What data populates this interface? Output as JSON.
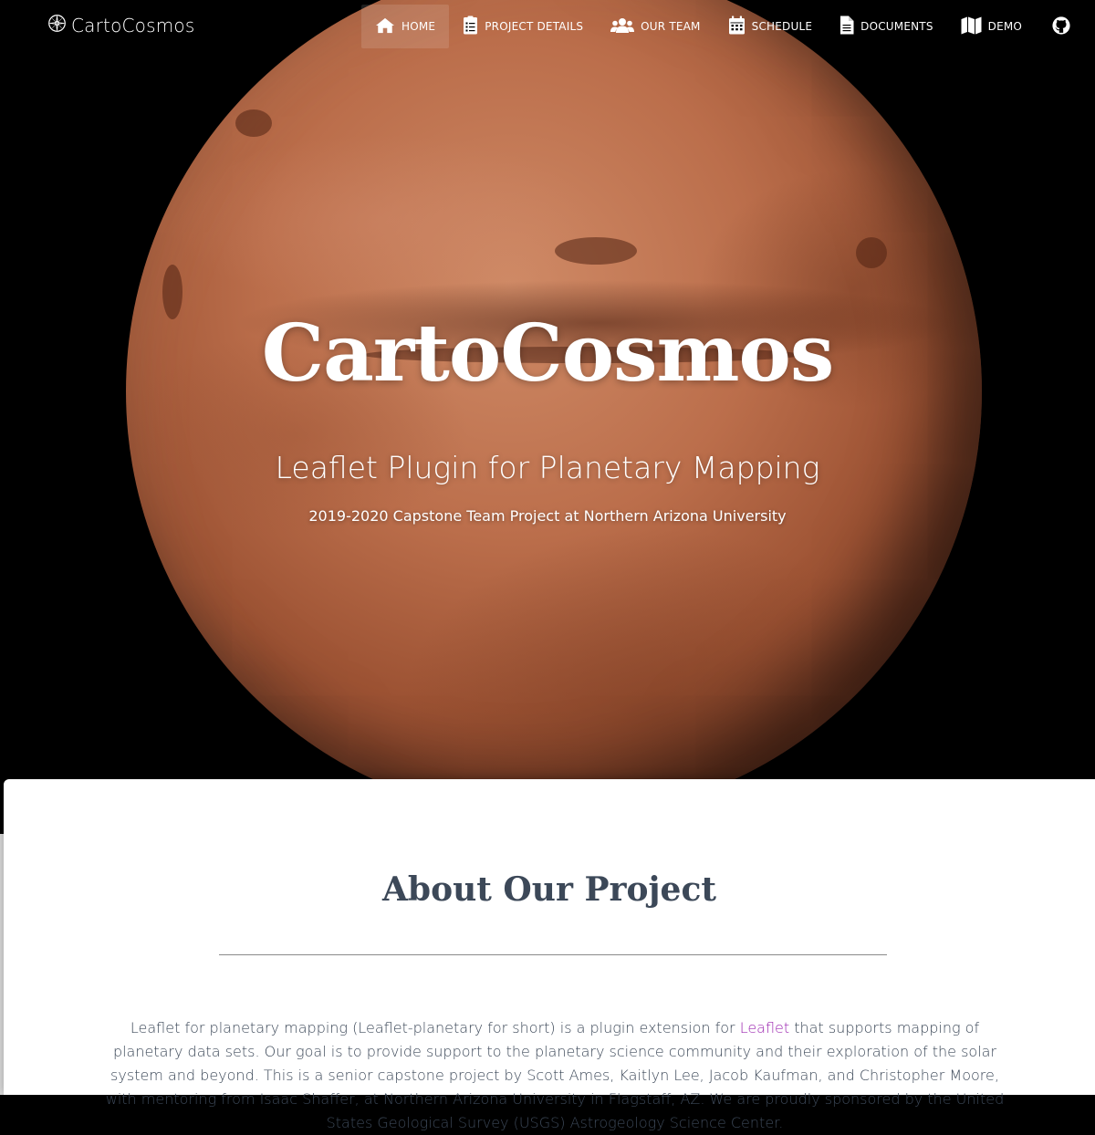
{
  "brand": {
    "name": "CartoCosmos",
    "icon": "compass-icon"
  },
  "nav": {
    "items": [
      {
        "label": "Home",
        "icon": "home-icon",
        "active": true
      },
      {
        "label": "Project Details",
        "icon": "clipboard-list-icon",
        "active": false
      },
      {
        "label": "Our Team",
        "icon": "users-icon",
        "active": false
      },
      {
        "label": "Schedule",
        "icon": "calendar-icon",
        "active": false
      },
      {
        "label": "Documents",
        "icon": "file-icon",
        "active": false
      },
      {
        "label": "Demo",
        "icon": "map-icon",
        "active": false
      }
    ],
    "github_icon": "github-icon"
  },
  "hero": {
    "title": "CartoCosmos",
    "subtitle": "Leaflet Plugin for Planetary Mapping",
    "caption": "2019-2020 Capstone Team Project at Northern Arizona University"
  },
  "about": {
    "heading": "About Our Project",
    "paragraph_before_link": "Leaflet for planetary mapping (Leaflet-planetary for short) is a plugin extension for ",
    "link_text": "Leaflet",
    "paragraph_after_link": " that supports mapping of planetary data sets. Our goal is to provide support to the planetary science community and their exploration of the solar system and beyond. This is a senior capstone project by Scott Ames, Kaitlyn Lee, Jacob Kaufman, and Christopher Moore, with mentoring from Isaac Shaffer, at Northern Arizona University in Flagstaff, AZ. We are proudly sponsored by the United States Geological Survey (USGS) Astrogeology Science Center."
  },
  "colors": {
    "heading": "#3c4858",
    "link": "#9c27b0",
    "hero_background": "#000000",
    "planet": "#bb6e4b"
  }
}
